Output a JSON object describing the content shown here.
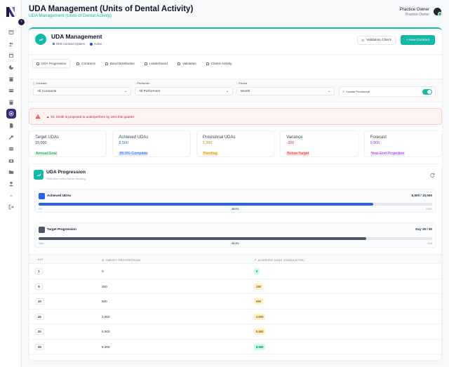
{
  "header": {
    "title": "UDA Management (Units of Dental Activity)",
    "subtitle": "UDA Management (Units of Dental Activity)",
    "user_name": "Practice Owner",
    "user_role": "Practice Owner"
  },
  "sidebar": {
    "logo": "N",
    "collapse_icon": "chevron-right-icon",
    "items": [
      {
        "icon": "window-icon",
        "active": false
      },
      {
        "icon": "users-icon",
        "active": false
      },
      {
        "icon": "calendar-icon",
        "active": false
      },
      {
        "icon": "chart-pie-icon",
        "active": false
      },
      {
        "icon": "building-icon",
        "active": false
      },
      {
        "icon": "credit-card-icon",
        "active": false
      },
      {
        "icon": "calculator-icon",
        "active": false
      },
      {
        "icon": "target-icon",
        "active": true
      },
      {
        "icon": "document-icon",
        "active": false
      },
      {
        "icon": "wrench-icon",
        "active": false
      },
      {
        "icon": "team-icon",
        "active": false
      },
      {
        "icon": "camera-icon",
        "active": false
      },
      {
        "icon": "folder-icon",
        "active": false
      },
      {
        "icon": "user-icon",
        "active": false
      },
      {
        "icon": "dash-icon",
        "active": false
      },
      {
        "icon": "logout-icon",
        "active": false
      }
    ]
  },
  "main": {
    "title": "UDA Management",
    "badges": [
      "NHS Contract System",
      "Active"
    ],
    "validation_button": "Validation Check",
    "new_contract_button": "+ New Contract",
    "tabs": [
      {
        "label": "UDA Progression",
        "icon": "chart-icon",
        "active": true
      },
      {
        "label": "Contracts",
        "icon": "document-icon",
        "active": false
      },
      {
        "label": "Band Distribution",
        "icon": "bars-icon",
        "active": false
      },
      {
        "label": "Leaderboard",
        "icon": "trophy-icon",
        "active": false
      },
      {
        "label": "Validation",
        "icon": "shield-icon",
        "active": false
      },
      {
        "label": "Claims Activity",
        "icon": "clipboard-icon",
        "active": false
      }
    ]
  },
  "filters": {
    "contract_label": "Contract",
    "contract_value": "All Contracts",
    "performer_label": "Performer",
    "performer_value": "All Performers",
    "period_label": "Period",
    "period_value": "Month",
    "include_provisional_label": "Include Provisional",
    "include_provisional_on": true
  },
  "alert": {
    "text": "Dr. Smith is projected to underperform by 15% this quarter."
  },
  "stats": [
    {
      "label": "Target UDAs",
      "value": "10,000",
      "note": "Annual Goal",
      "value_color": "#374151",
      "note_color": "#15803d",
      "note_bg": "#dcfce7"
    },
    {
      "label": "Achieved UDAs",
      "value": "8,500",
      "note": "85.0% Complete",
      "value_color": "#2563eb",
      "note_color": "#2563eb",
      "note_bg": "#dbeafe"
    },
    {
      "label": "Provisional UDAs",
      "value": "1,200",
      "note": "Pending",
      "value_color": "#d97706",
      "note_color": "#d97706",
      "note_bg": "#fef3c7"
    },
    {
      "label": "Variance",
      "value": "-300",
      "note": "Below Target",
      "value_color": "#dc2626",
      "note_color": "#dc2626",
      "note_bg": "#fee2e2"
    },
    {
      "label": "Forecast",
      "value": "9,800",
      "note": "Year-End Projection",
      "value_color": "#9333ea",
      "note_color": "#9333ea",
      "note_bg": "#f3e8ff"
    }
  ],
  "progression": {
    "title": "UDA Progression",
    "subtitle": "Real-time performance tracking",
    "achieved_card": {
      "title": "Achieved UDAs",
      "right_text": "8,500 / 10,000",
      "fill_fraction": 0.85,
      "left_label": "0%",
      "mid_label": "85.0%",
      "right_label": "100%",
      "color": "#2563eb"
    },
    "target_card": {
      "title": "Target Progression",
      "right_text": "Day 25 / 30",
      "fill_fraction": 0.833,
      "left_label": "Start",
      "mid_label": "83.3%",
      "right_label": "End",
      "color": "#4b5563"
    },
    "table": {
      "headers": [
        "DAY",
        "TARGET PROGRESSION",
        "ACHIEVED UDAS (CUMULATIVE)"
      ],
      "rows": [
        {
          "day": "1",
          "target": "0",
          "achieved": "0",
          "achieved_color": "#0f766e",
          "achieved_bg": "#ccfbf1"
        },
        {
          "day": "5",
          "target": "300",
          "achieved": "250",
          "achieved_color": "#b45309",
          "achieved_bg": "#fef3c7"
        },
        {
          "day": "10",
          "target": "600",
          "achieved": "550",
          "achieved_color": "#b45309",
          "achieved_bg": "#fef3c7"
        },
        {
          "day": "15",
          "target": "3,000",
          "achieved": "2,600",
          "achieved_color": "#b45309",
          "achieved_bg": "#fef3c7"
        },
        {
          "day": "20",
          "target": "6,000",
          "achieved": "5,800",
          "achieved_color": "#b45309",
          "achieved_bg": "#fef3c7"
        },
        {
          "day": "25",
          "target": "8,300",
          "achieved": "8,500",
          "achieved_color": "#0f766e",
          "achieved_bg": "#ccfbf1"
        }
      ]
    }
  },
  "colors": {
    "accent": "#14b8a6",
    "sidebar_active": "#312e81"
  }
}
